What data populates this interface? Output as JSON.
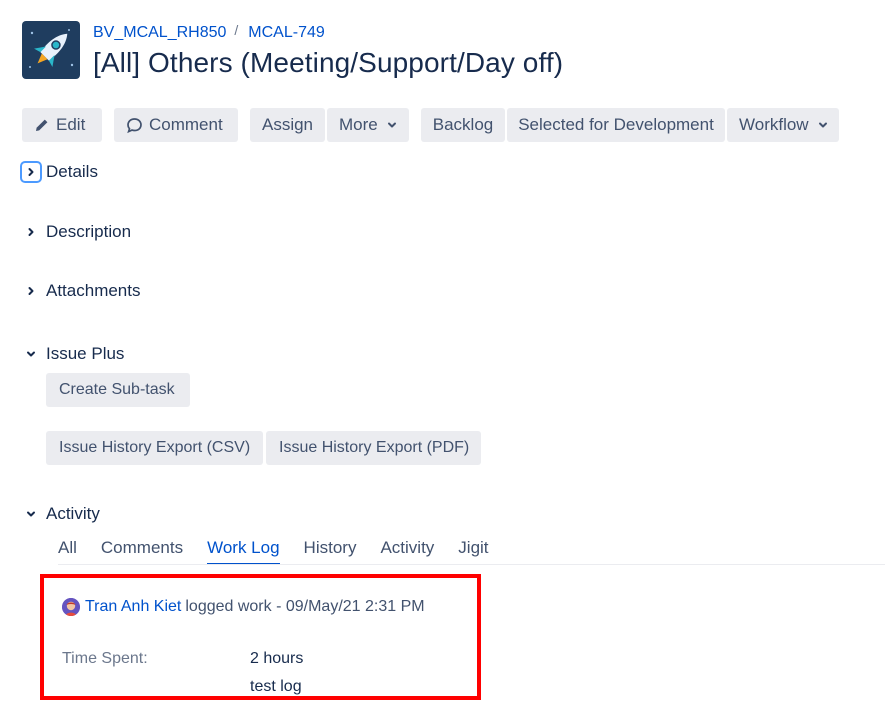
{
  "breadcrumb": {
    "project": "BV_MCAL_RH850",
    "separator": "/",
    "issue_key": "MCAL-749"
  },
  "issue": {
    "title": "[All] Others (Meeting/Support/Day off)"
  },
  "toolbar": {
    "edit": "Edit",
    "comment": "Comment",
    "assign": "Assign",
    "more": "More",
    "backlog": "Backlog",
    "selected_for_development": "Selected for Development",
    "workflow": "Workflow"
  },
  "sections": {
    "details": "Details",
    "description": "Description",
    "attachments": "Attachments",
    "issue_plus": "Issue Plus",
    "activity": "Activity"
  },
  "issue_plus": {
    "create_subtask": "Create Sub-task",
    "export_csv": "Issue History Export (CSV)",
    "export_pdf": "Issue History Export (PDF)"
  },
  "activity_tabs": [
    {
      "label": "All"
    },
    {
      "label": "Comments"
    },
    {
      "label": "Work Log",
      "active": true
    },
    {
      "label": "History"
    },
    {
      "label": "Activity"
    },
    {
      "label": "Jigit"
    }
  ],
  "worklog": {
    "user": "Tran Anh Kiet",
    "action": "logged work - 09/May/21 2:31 PM",
    "time_spent_label": "Time Spent:",
    "time_spent_value": "2 hours",
    "comment": "test log"
  },
  "colors": {
    "link": "#0052cc",
    "highlight_border": "#ff0000",
    "button_bg": "#ebecf0"
  }
}
